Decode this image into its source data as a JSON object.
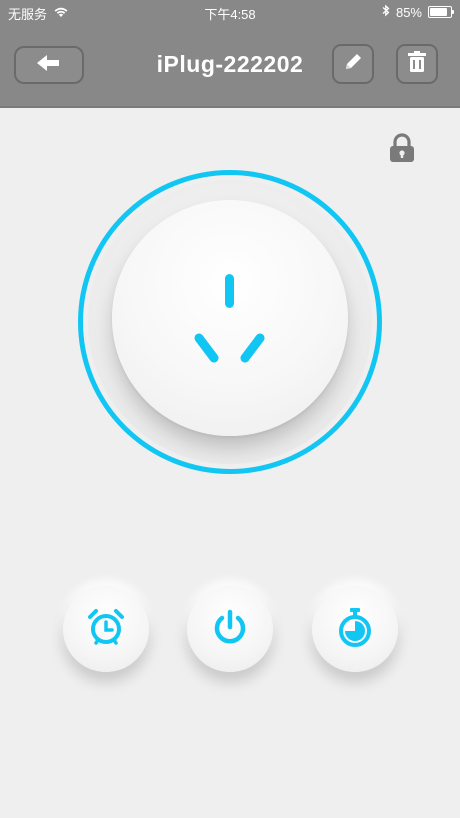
{
  "status_bar": {
    "carrier": "无服务",
    "time": "下午4:58",
    "battery_percent": "85%",
    "battery_level": 0.85,
    "icons": [
      "wifi-icon",
      "bluetooth-icon",
      "battery-icon"
    ]
  },
  "header": {
    "title": "iPlug-222202",
    "back_icon": "arrow-left-icon",
    "edit_icon": "pencil-icon",
    "delete_icon": "trash-icon"
  },
  "controls": {
    "lock_icon": "lock-icon",
    "socket_icon": "power-socket-icon",
    "bottom_buttons": [
      {
        "name": "timer",
        "icon": "alarm-clock-icon"
      },
      {
        "name": "power",
        "icon": "power-icon"
      },
      {
        "name": "countdown",
        "icon": "stopwatch-icon"
      }
    ]
  },
  "colors": {
    "accent": "#12c6f3",
    "header_bg": "#888888",
    "background": "#efefef"
  }
}
